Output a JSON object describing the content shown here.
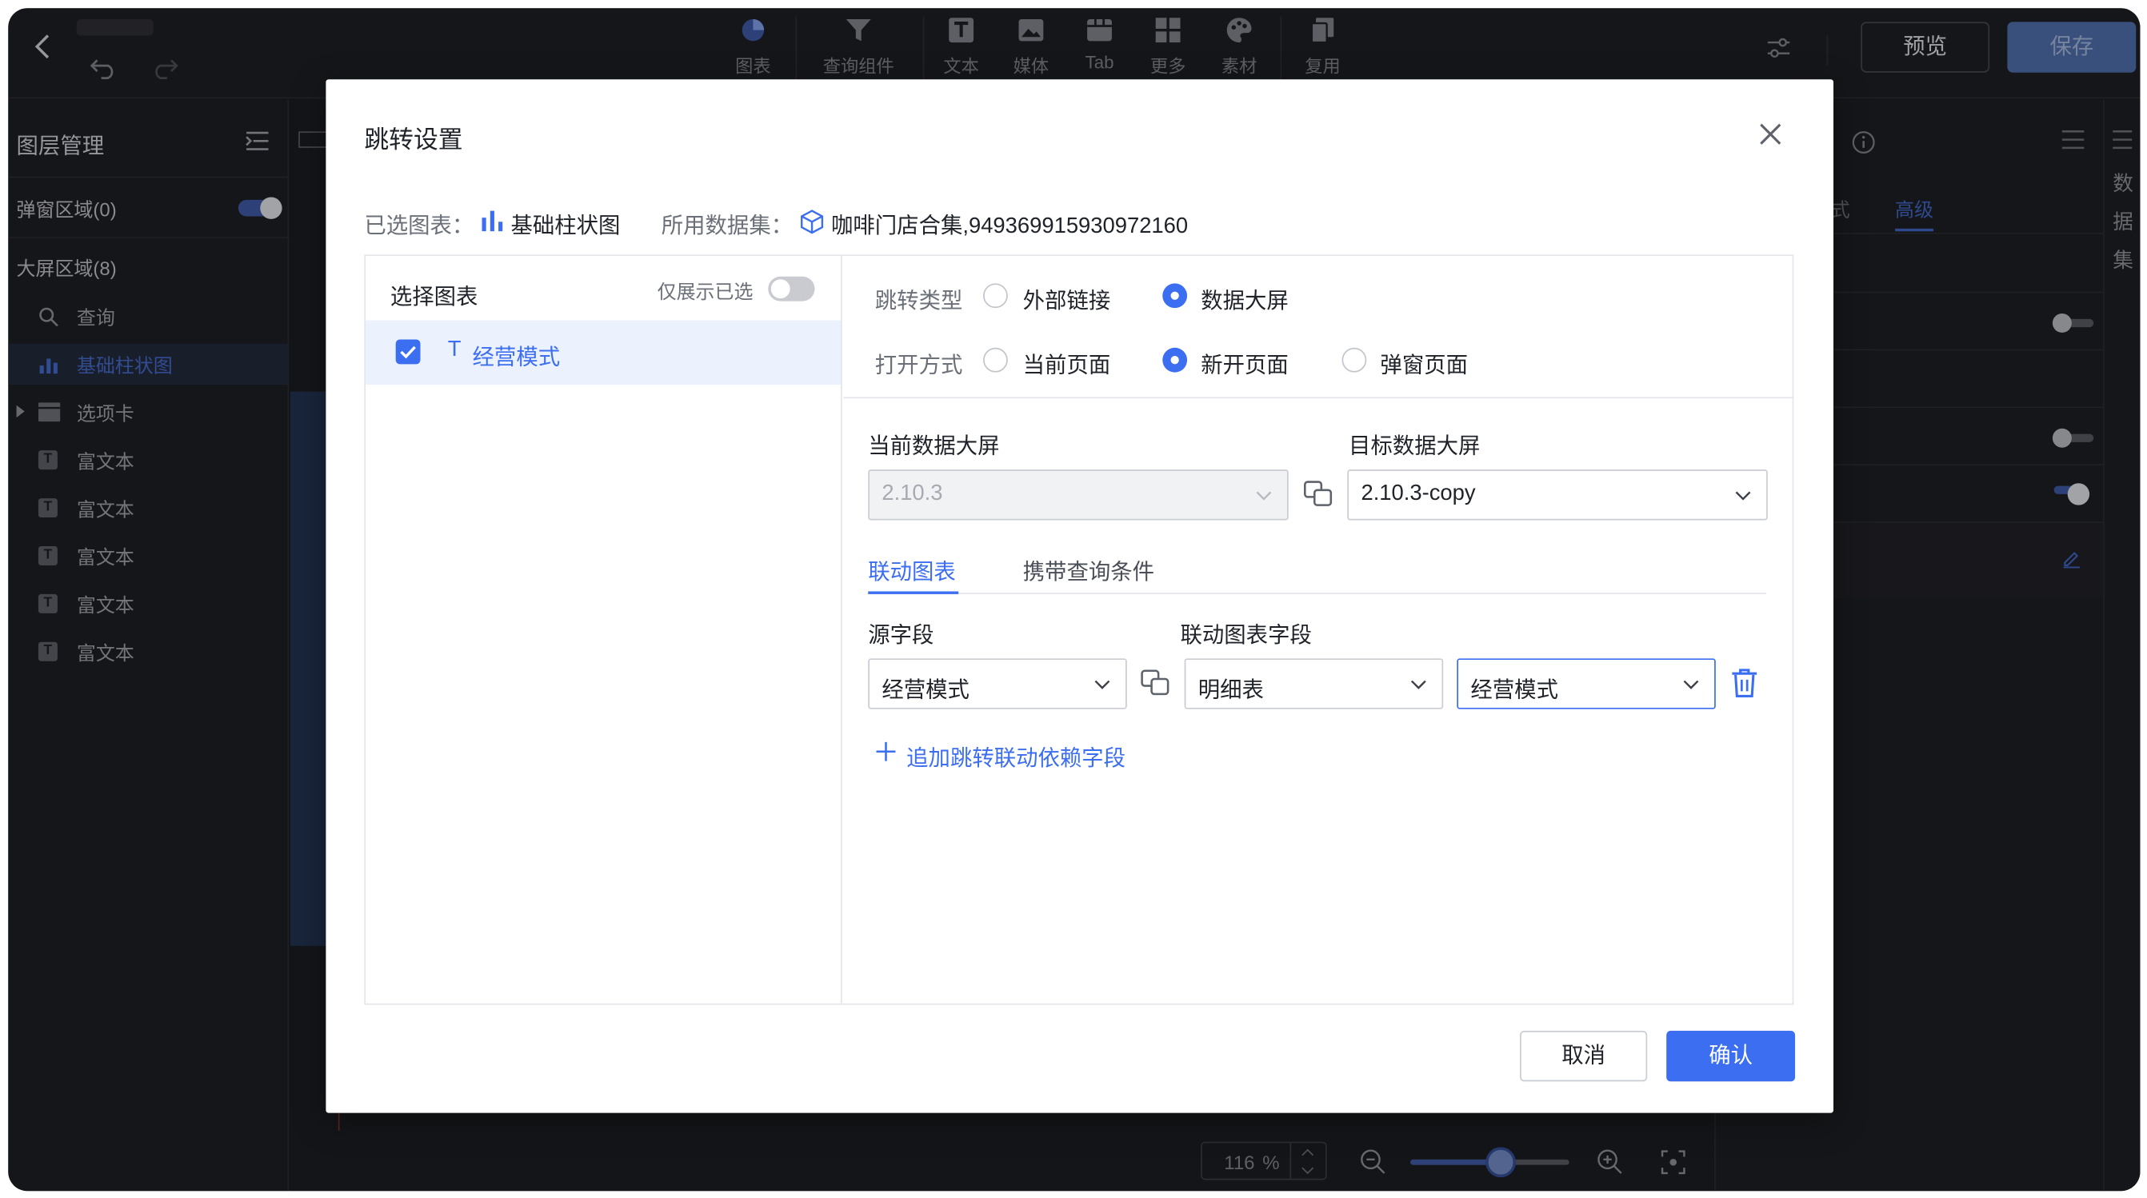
{
  "app": {
    "toolbar": {
      "items": [
        {
          "label": "图表",
          "icon": "pie-chart-icon"
        },
        {
          "label": "查询组件",
          "icon": "filter-icon"
        },
        {
          "label": "文本",
          "icon": "text-icon"
        },
        {
          "label": "媒体",
          "icon": "image-icon"
        },
        {
          "label": "Tab",
          "icon": "tab-icon"
        },
        {
          "label": "更多",
          "icon": "grid-icon"
        },
        {
          "label": "素材",
          "icon": "palette-icon"
        },
        {
          "label": "复用",
          "icon": "copy-icon"
        }
      ],
      "preview_label": "预览",
      "save_label": "保存"
    },
    "layers": {
      "title": "图层管理",
      "popup_area": "弹窗区域(0)",
      "screen_area": "大屏区域(8)",
      "items": [
        {
          "label": "查询"
        },
        {
          "label": "基础柱状图"
        },
        {
          "label": "选项卡"
        },
        {
          "label": "富文本"
        },
        {
          "label": "富文本"
        },
        {
          "label": "富文本"
        },
        {
          "label": "富文本"
        },
        {
          "label": "富文本"
        }
      ]
    },
    "right_panel": {
      "tab_style_partial": "式",
      "tab_advanced": "高级",
      "vertical_tab": "数据集",
      "vertical_chars": [
        "数",
        "据",
        "集"
      ]
    },
    "zoom": {
      "value": "116",
      "unit": "%",
      "slider_level": 0.57
    }
  },
  "modal": {
    "title": "跳转设置",
    "selected_chart_label": "已选图表：",
    "selected_chart_value": "基础柱状图",
    "dataset_label": "所用数据集：",
    "dataset_value": "咖啡门店合集,949369915930972160",
    "left": {
      "title": "选择图表",
      "only_selected_label": "仅展示已选",
      "only_selected_on": false,
      "items": [
        {
          "prefix": "T",
          "label": "经营模式",
          "checked": true
        }
      ]
    },
    "jump_type": {
      "label": "跳转类型",
      "options": [
        "外部链接",
        "数据大屏"
      ],
      "selected": "数据大屏"
    },
    "open_mode": {
      "label": "打开方式",
      "options": [
        "当前页面",
        "新开页面",
        "弹窗页面"
      ],
      "selected": "新开页面"
    },
    "current_screen": {
      "label": "当前数据大屏",
      "value": "2.10.3"
    },
    "target_screen": {
      "label": "目标数据大屏",
      "value": "2.10.3-copy"
    },
    "tabs": {
      "active": "联动图表",
      "inactive": "携带查询条件"
    },
    "fields": {
      "source_label": "源字段",
      "target_label": "联动图表字段",
      "source_value": "经营模式",
      "target_table": "明细表",
      "target_field": "经营模式"
    },
    "add_link": "追加跳转联动依赖字段",
    "cancel_label": "取消",
    "ok_label": "确认"
  }
}
